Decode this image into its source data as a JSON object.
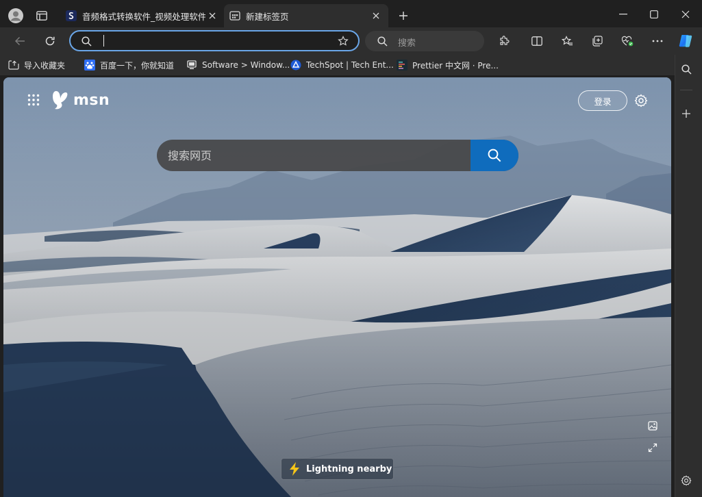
{
  "tabs": [
    {
      "label": "音频格式转换软件_视频处理软件_",
      "active": false,
      "favicon": "app-s-favicon-icon"
    },
    {
      "label": "新建标签页",
      "active": true,
      "favicon": "new-tab-favicon-icon"
    }
  ],
  "toolbar": {
    "address_value": "",
    "search_placeholder": "搜索"
  },
  "favorites": [
    {
      "label": "导入收藏夹",
      "icon": "import-favorites-icon"
    },
    {
      "label": "百度一下，你就知道",
      "icon": "baidu-paw-icon"
    },
    {
      "label": "Software > Window...",
      "icon": "software-favicon-icon"
    },
    {
      "label": "TechSpot | Tech Ent...",
      "icon": "techspot-favicon-icon"
    },
    {
      "label": "Prettier 中文网 · Pre...",
      "icon": "prettier-favicon-icon"
    }
  ],
  "msn": {
    "logo_text": "msn",
    "login_label": "登录",
    "search_placeholder": "搜索网页",
    "lightning_label": "Lightning nearby"
  },
  "colors": {
    "accent": "#0f6cbd",
    "frame": "#202020",
    "toolbar": "#2e2e2e",
    "address_focus": "#6aa6e8"
  }
}
